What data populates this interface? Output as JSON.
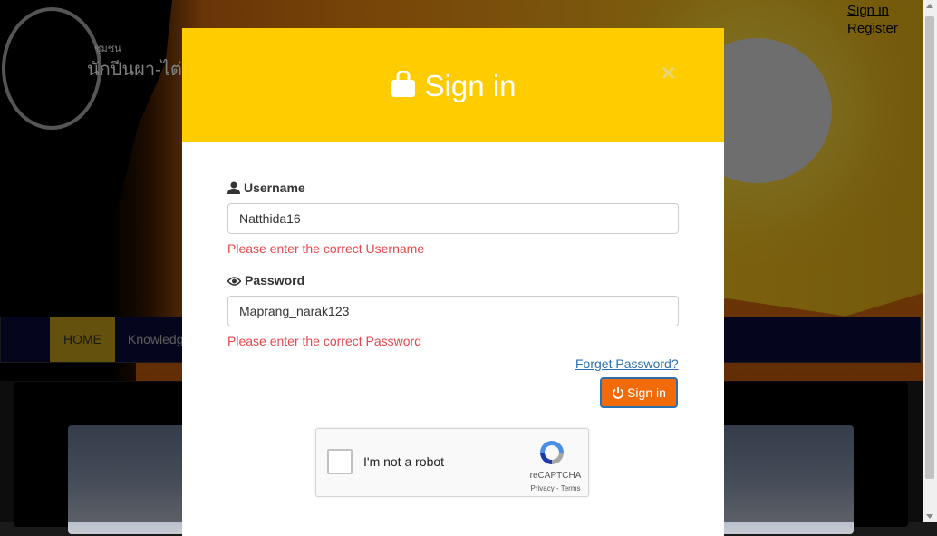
{
  "site": {
    "logo_small": "ชุมชน",
    "logo_text": "นักปีนผา-ไต่เข",
    "toplinks": {
      "signin": "Sign in",
      "register": "Register"
    },
    "nav": {
      "home": "HOME",
      "knowledge": "Knowledg"
    }
  },
  "modal": {
    "title": "Sign in",
    "close_label": "×",
    "username": {
      "label": "Username",
      "value": "Natthida16",
      "error": "Please enter the correct Username"
    },
    "password": {
      "label": "Password",
      "value": "Maprang_narak123",
      "error": "Please enter the correct Password"
    },
    "forgot_label": "Forget Password?",
    "submit_label": "Sign in",
    "captcha": {
      "label": "I'm not a robot",
      "brand": "reCAPTCHA",
      "links": "Privacy - Terms"
    }
  },
  "colors": {
    "header_bg": "#ffcc00",
    "button_bg": "#f26b0a",
    "error_text": "#e9474b",
    "link": "#2a6fb0"
  }
}
